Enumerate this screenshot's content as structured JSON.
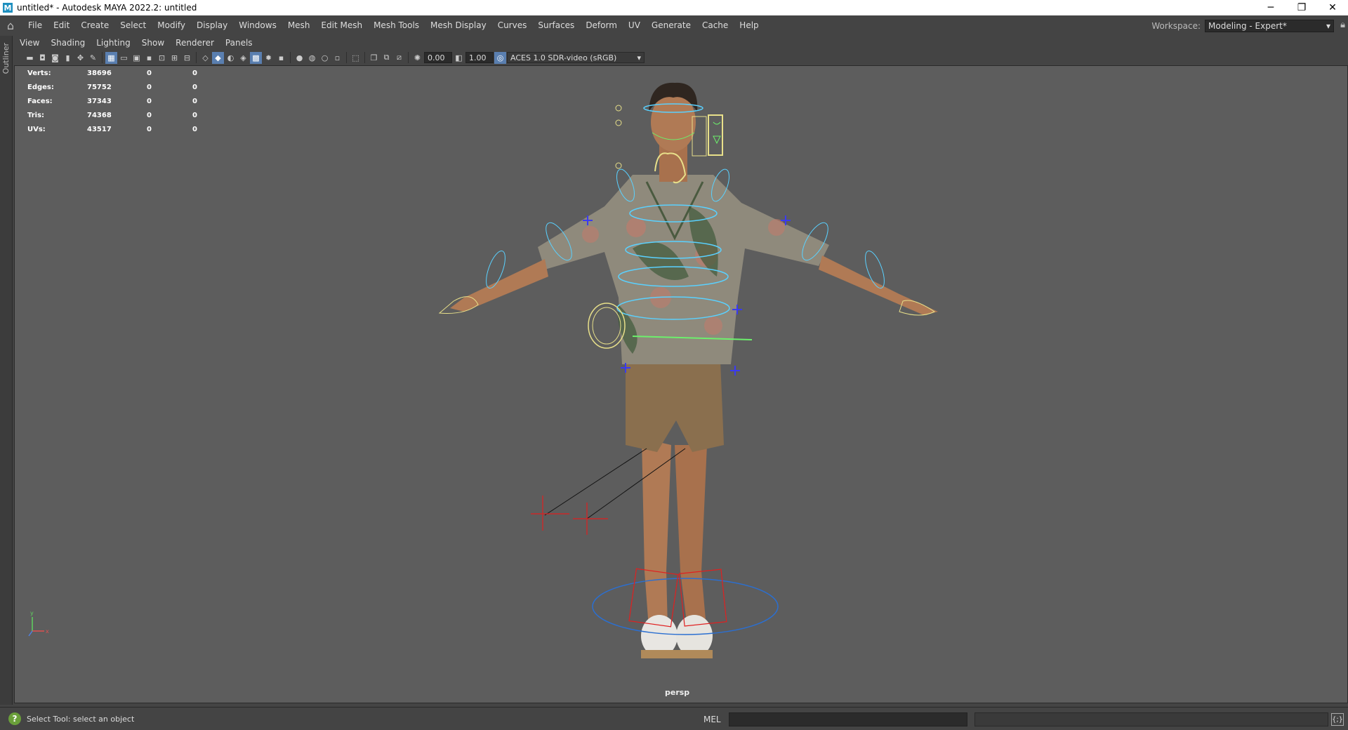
{
  "window": {
    "title": "untitled* - Autodesk MAYA 2022.2: untitled",
    "logo": "M",
    "controls": {
      "minimize": "─",
      "restore": "❐",
      "close": "✕"
    }
  },
  "menubar": {
    "items": [
      "File",
      "Edit",
      "Create",
      "Select",
      "Modify",
      "Display",
      "Windows",
      "Mesh",
      "Edit Mesh",
      "Mesh Tools",
      "Mesh Display",
      "Curves",
      "Surfaces",
      "Deform",
      "UV",
      "Generate",
      "Cache",
      "Help"
    ],
    "workspace_label": "Workspace:",
    "workspace_value": "Modeling - Expert*"
  },
  "outliner": {
    "label": "Outliner"
  },
  "panel_menu": {
    "items": [
      "View",
      "Shading",
      "Lighting",
      "Show",
      "Renderer",
      "Panels"
    ]
  },
  "toolbar": {
    "exposure": "0.00",
    "gamma": "1.00",
    "colorspace": "ACES 1.0 SDR-video (sRGB)"
  },
  "hud": {
    "rows": [
      {
        "label": "Verts:",
        "v1": "38696",
        "v2": "0",
        "v3": "0"
      },
      {
        "label": "Edges:",
        "v1": "75752",
        "v2": "0",
        "v3": "0"
      },
      {
        "label": "Faces:",
        "v1": "37343",
        "v2": "0",
        "v3": "0"
      },
      {
        "label": "Tris:",
        "v1": "74368",
        "v2": "0",
        "v3": "0"
      },
      {
        "label": "UVs:",
        "v1": "43517",
        "v2": "0",
        "v3": "0"
      }
    ]
  },
  "viewport": {
    "camera": "persp",
    "axis": {
      "x": "x",
      "y": "y"
    }
  },
  "statusbar": {
    "help_text": "Select Tool: select an object",
    "mel_label": "MEL"
  }
}
